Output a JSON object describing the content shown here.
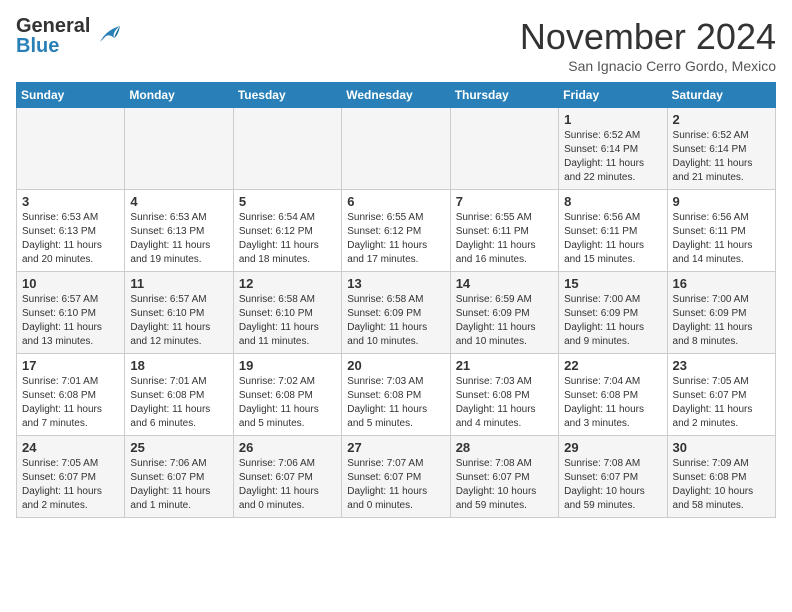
{
  "header": {
    "logo_line1": "General",
    "logo_line2": "Blue",
    "month": "November 2024",
    "location": "San Ignacio Cerro Gordo, Mexico"
  },
  "days_of_week": [
    "Sunday",
    "Monday",
    "Tuesday",
    "Wednesday",
    "Thursday",
    "Friday",
    "Saturday"
  ],
  "weeks": [
    [
      {
        "day": "",
        "info": ""
      },
      {
        "day": "",
        "info": ""
      },
      {
        "day": "",
        "info": ""
      },
      {
        "day": "",
        "info": ""
      },
      {
        "day": "",
        "info": ""
      },
      {
        "day": "1",
        "info": "Sunrise: 6:52 AM\nSunset: 6:14 PM\nDaylight: 11 hours\nand 22 minutes."
      },
      {
        "day": "2",
        "info": "Sunrise: 6:52 AM\nSunset: 6:14 PM\nDaylight: 11 hours\nand 21 minutes."
      }
    ],
    [
      {
        "day": "3",
        "info": "Sunrise: 6:53 AM\nSunset: 6:13 PM\nDaylight: 11 hours\nand 20 minutes."
      },
      {
        "day": "4",
        "info": "Sunrise: 6:53 AM\nSunset: 6:13 PM\nDaylight: 11 hours\nand 19 minutes."
      },
      {
        "day": "5",
        "info": "Sunrise: 6:54 AM\nSunset: 6:12 PM\nDaylight: 11 hours\nand 18 minutes."
      },
      {
        "day": "6",
        "info": "Sunrise: 6:55 AM\nSunset: 6:12 PM\nDaylight: 11 hours\nand 17 minutes."
      },
      {
        "day": "7",
        "info": "Sunrise: 6:55 AM\nSunset: 6:11 PM\nDaylight: 11 hours\nand 16 minutes."
      },
      {
        "day": "8",
        "info": "Sunrise: 6:56 AM\nSunset: 6:11 PM\nDaylight: 11 hours\nand 15 minutes."
      },
      {
        "day": "9",
        "info": "Sunrise: 6:56 AM\nSunset: 6:11 PM\nDaylight: 11 hours\nand 14 minutes."
      }
    ],
    [
      {
        "day": "10",
        "info": "Sunrise: 6:57 AM\nSunset: 6:10 PM\nDaylight: 11 hours\nand 13 minutes."
      },
      {
        "day": "11",
        "info": "Sunrise: 6:57 AM\nSunset: 6:10 PM\nDaylight: 11 hours\nand 12 minutes."
      },
      {
        "day": "12",
        "info": "Sunrise: 6:58 AM\nSunset: 6:10 PM\nDaylight: 11 hours\nand 11 minutes."
      },
      {
        "day": "13",
        "info": "Sunrise: 6:58 AM\nSunset: 6:09 PM\nDaylight: 11 hours\nand 10 minutes."
      },
      {
        "day": "14",
        "info": "Sunrise: 6:59 AM\nSunset: 6:09 PM\nDaylight: 11 hours\nand 10 minutes."
      },
      {
        "day": "15",
        "info": "Sunrise: 7:00 AM\nSunset: 6:09 PM\nDaylight: 11 hours\nand 9 minutes."
      },
      {
        "day": "16",
        "info": "Sunrise: 7:00 AM\nSunset: 6:09 PM\nDaylight: 11 hours\nand 8 minutes."
      }
    ],
    [
      {
        "day": "17",
        "info": "Sunrise: 7:01 AM\nSunset: 6:08 PM\nDaylight: 11 hours\nand 7 minutes."
      },
      {
        "day": "18",
        "info": "Sunrise: 7:01 AM\nSunset: 6:08 PM\nDaylight: 11 hours\nand 6 minutes."
      },
      {
        "day": "19",
        "info": "Sunrise: 7:02 AM\nSunset: 6:08 PM\nDaylight: 11 hours\nand 5 minutes."
      },
      {
        "day": "20",
        "info": "Sunrise: 7:03 AM\nSunset: 6:08 PM\nDaylight: 11 hours\nand 5 minutes."
      },
      {
        "day": "21",
        "info": "Sunrise: 7:03 AM\nSunset: 6:08 PM\nDaylight: 11 hours\nand 4 minutes."
      },
      {
        "day": "22",
        "info": "Sunrise: 7:04 AM\nSunset: 6:08 PM\nDaylight: 11 hours\nand 3 minutes."
      },
      {
        "day": "23",
        "info": "Sunrise: 7:05 AM\nSunset: 6:07 PM\nDaylight: 11 hours\nand 2 minutes."
      }
    ],
    [
      {
        "day": "24",
        "info": "Sunrise: 7:05 AM\nSunset: 6:07 PM\nDaylight: 11 hours\nand 2 minutes."
      },
      {
        "day": "25",
        "info": "Sunrise: 7:06 AM\nSunset: 6:07 PM\nDaylight: 11 hours\nand 1 minute."
      },
      {
        "day": "26",
        "info": "Sunrise: 7:06 AM\nSunset: 6:07 PM\nDaylight: 11 hours\nand 0 minutes."
      },
      {
        "day": "27",
        "info": "Sunrise: 7:07 AM\nSunset: 6:07 PM\nDaylight: 11 hours\nand 0 minutes."
      },
      {
        "day": "28",
        "info": "Sunrise: 7:08 AM\nSunset: 6:07 PM\nDaylight: 10 hours\nand 59 minutes."
      },
      {
        "day": "29",
        "info": "Sunrise: 7:08 AM\nSunset: 6:07 PM\nDaylight: 10 hours\nand 59 minutes."
      },
      {
        "day": "30",
        "info": "Sunrise: 7:09 AM\nSunset: 6:08 PM\nDaylight: 10 hours\nand 58 minutes."
      }
    ]
  ]
}
